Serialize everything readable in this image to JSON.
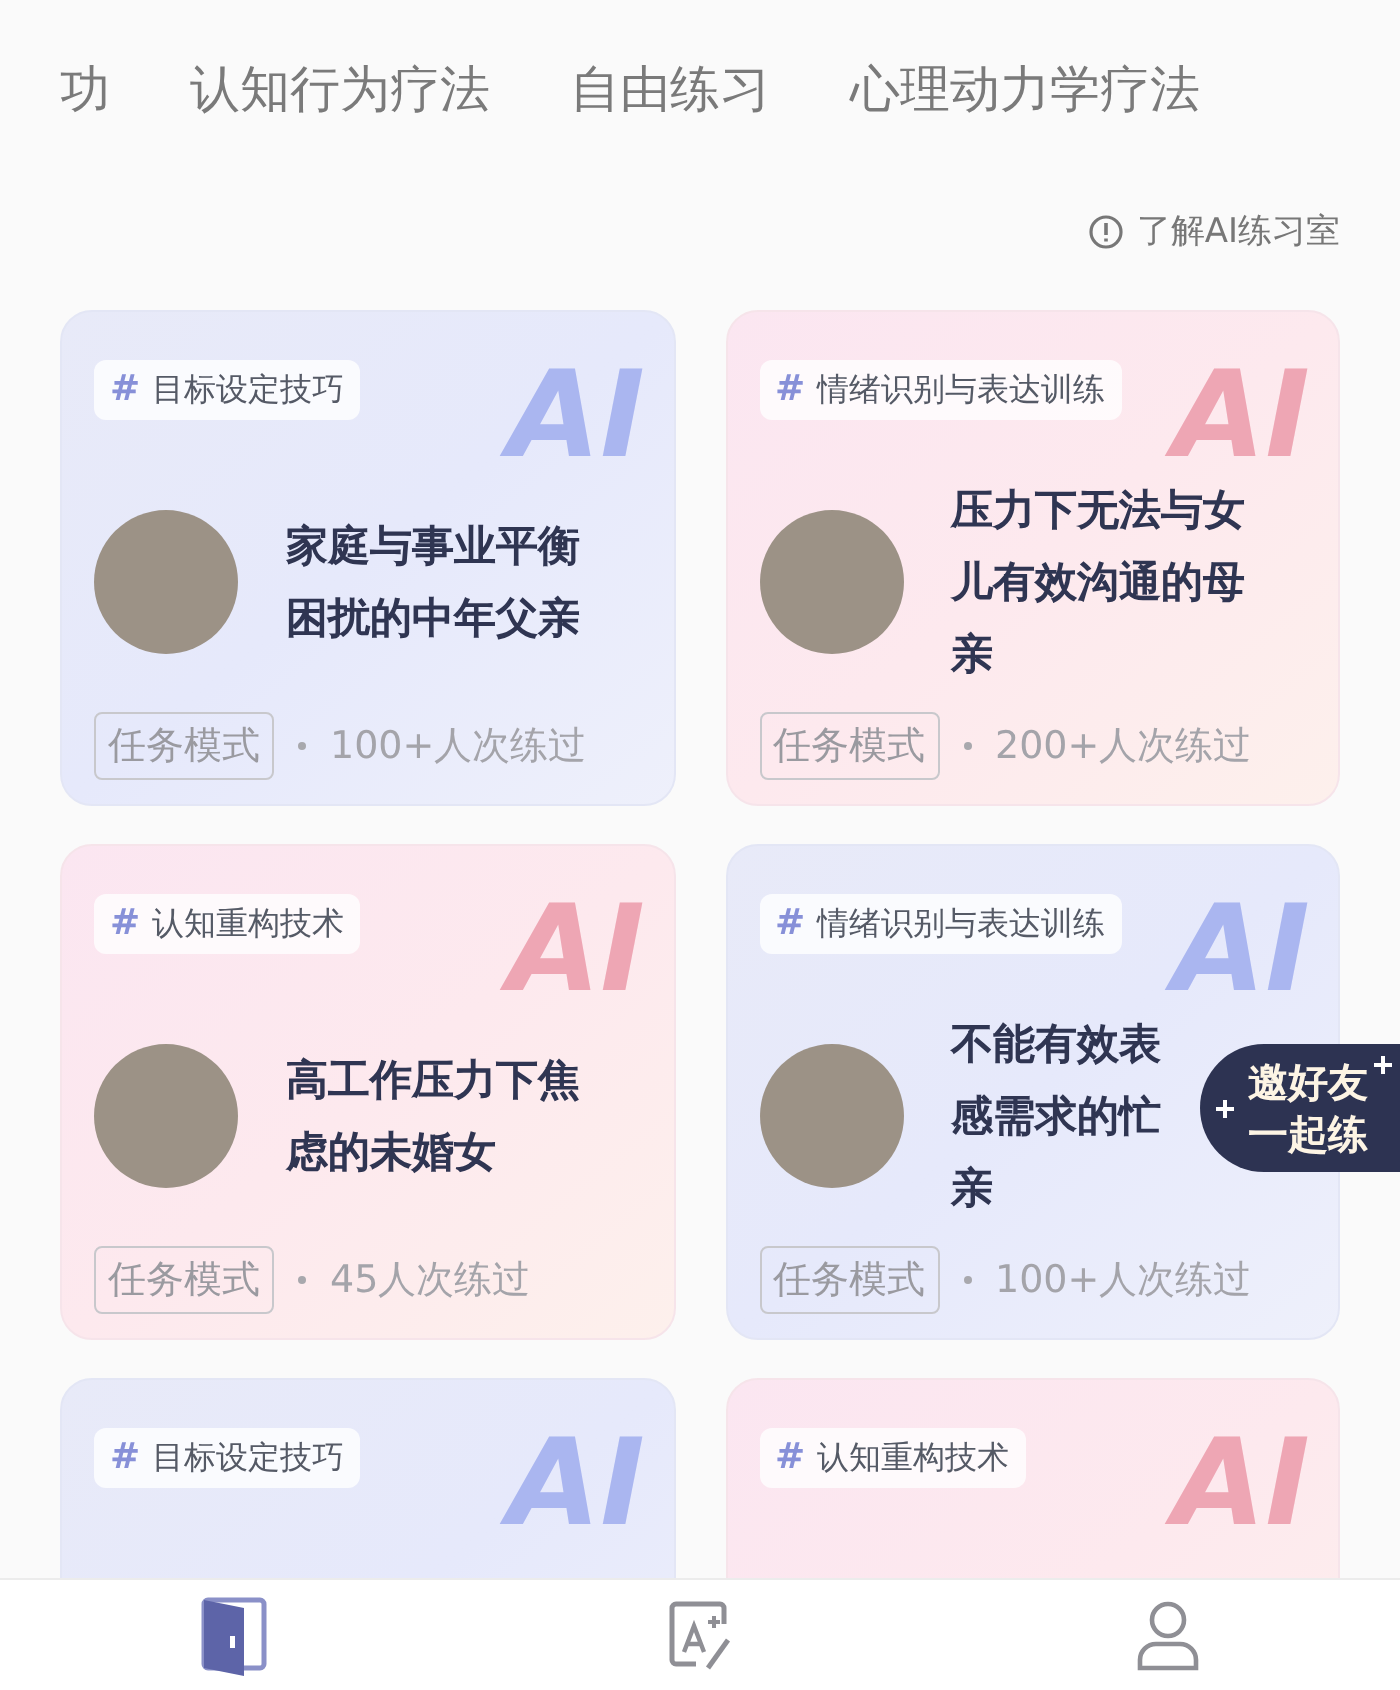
{
  "tabs": [
    {
      "label": "功",
      "selected": false
    },
    {
      "label": "认知行为疗法",
      "selected": false
    },
    {
      "label": "自由练习",
      "selected": false
    },
    {
      "label": "心理动力学疗法",
      "selected": false
    }
  ],
  "info_link": "了解AI练习室",
  "cards": [
    {
      "kind": "lavender",
      "tag_mark": "#",
      "tag": "目标设定技巧",
      "emblem": "AI",
      "title_lines": [
        "家庭与事业平衡",
        "困扰的中年父亲"
      ],
      "mode": "任务模式",
      "count": "100+人次练过"
    },
    {
      "kind": "rose",
      "tag_mark": "#",
      "tag": "情绪识别与表达训练",
      "emblem": "AI",
      "title_lines": [
        "压力下无法与女",
        "儿有效沟通的母",
        "亲"
      ],
      "mode": "任务模式",
      "count": "200+人次练过"
    },
    {
      "kind": "rose",
      "tag_mark": "#",
      "tag": "认知重构技术",
      "emblem": "AI",
      "title_lines": [
        "高工作压力下焦",
        "虑的未婚女"
      ],
      "mode": "任务模式",
      "count": "45人次练过"
    },
    {
      "kind": "lavender",
      "tag_mark": "#",
      "tag": "情绪识别与表达训练",
      "emblem": "AI",
      "title_lines": [
        "不能有效表",
        "感需求的忙",
        "亲"
      ],
      "mode": "任务模式",
      "count": "100+人次练过"
    },
    {
      "kind": "lavender",
      "tag_mark": "#",
      "tag": "目标设定技巧",
      "emblem": "AI"
    },
    {
      "kind": "rose",
      "tag_mark": "#",
      "tag": "认知重构技术",
      "emblem": "AI"
    }
  ],
  "invite_button": {
    "lines": [
      "邀好友",
      "一起练"
    ]
  },
  "bottom_nav": [
    {
      "kind": "door",
      "selected": true
    },
    {
      "kind": "edit",
      "selected": false
    },
    {
      "kind": "profile",
      "selected": false
    }
  ]
}
